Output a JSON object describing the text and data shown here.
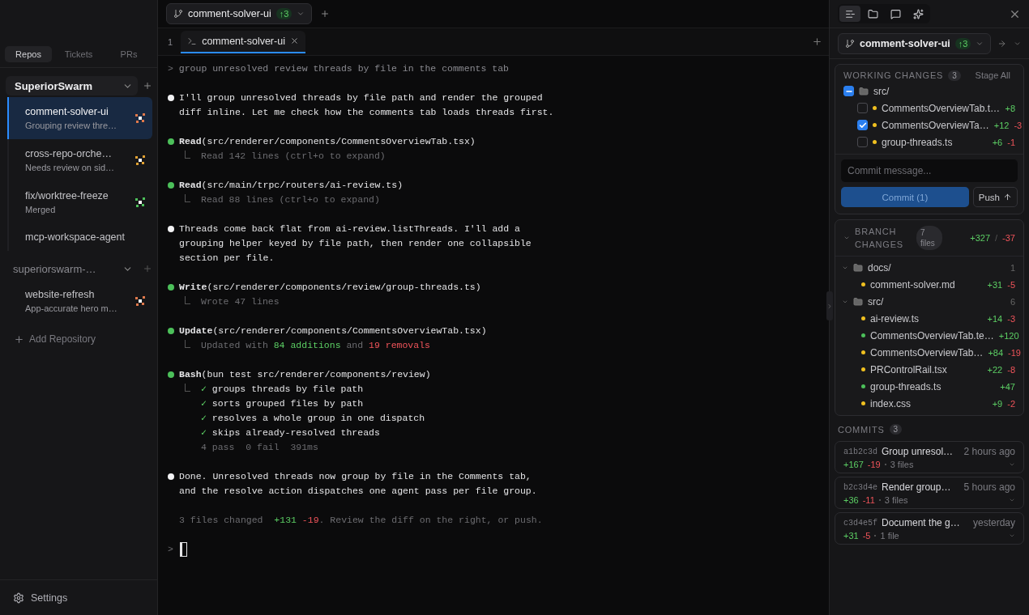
{
  "sidebar": {
    "tabs": [
      {
        "label": "Repos",
        "selected": true
      },
      {
        "label": "Tickets",
        "selected": false
      },
      {
        "label": "PRs",
        "selected": false
      }
    ],
    "groups": [
      {
        "name": "SuperiorSwarm",
        "selected": true,
        "expanded": true,
        "items": [
          {
            "title": "comment-solver-ui",
            "subtitle": "Grouping review thre…",
            "selected": true,
            "color": "#e0784a"
          },
          {
            "title": "cross-repo-orche…",
            "subtitle": "Needs review on sid…",
            "selected": false,
            "color": "#e0a030"
          },
          {
            "title": "fix/worktree-freeze",
            "subtitle": "Merged",
            "selected": false,
            "color": "#4cc05a"
          },
          {
            "title": "mcp-workspace-agent",
            "selected": false
          }
        ]
      },
      {
        "name": "superiorswarm-…",
        "selected": false,
        "expanded": true,
        "items": [
          {
            "title": "website-refresh",
            "subtitle": "App-accurate hero m…",
            "selected": false,
            "color": "#e0784a"
          }
        ]
      }
    ],
    "add_repository": "Add Repository",
    "settings": "Settings"
  },
  "workspace": {
    "branch": "comment-solver-ui",
    "ahead": "↑3",
    "tabs": [
      {
        "index": "1",
        "label": "comment-solver-ui",
        "selected": true
      }
    ],
    "terminal": [
      {
        "kind": "prompt",
        "mark": ">",
        "text": "group unresolved review threads by file in the comments tab"
      },
      {
        "kind": "message",
        "lines": [
          "I'll group unresolved threads by file path and render the grouped",
          "diff inline. Let me check how the comments tab loads threads first."
        ]
      },
      {
        "kind": "tool",
        "name": "Read",
        "args": "(src/renderer/components/CommentsOverviewTab.tsx)",
        "output": [
          {
            "segments": [
              {
                "text": "Read 142 lines (ctrl+o to expand)",
                "kind": "muted"
              }
            ]
          }
        ]
      },
      {
        "kind": "tool",
        "name": "Read",
        "args": "(src/main/trpc/routers/ai-review.ts)",
        "output": [
          {
            "segments": [
              {
                "text": "Read 88 lines (ctrl+o to expand)",
                "kind": "muted"
              }
            ]
          }
        ]
      },
      {
        "kind": "message",
        "lines": [
          "Threads come back flat from ai-review.listThreads. I'll add a",
          "grouping helper keyed by file path, then render one collapsible",
          "section per file."
        ]
      },
      {
        "kind": "tool",
        "name": "Write",
        "args": "(src/renderer/components/review/group-threads.ts)",
        "output": [
          {
            "segments": [
              {
                "text": "Wrote 47 lines",
                "kind": "muted"
              }
            ]
          }
        ]
      },
      {
        "kind": "tool",
        "name": "Update",
        "args": "(src/renderer/components/CommentsOverviewTab.tsx)",
        "output": [
          {
            "segments": [
              {
                "text": "Updated with ",
                "kind": "muted"
              },
              {
                "text": "84 additions",
                "kind": "added"
              },
              {
                "text": " and ",
                "kind": "muted"
              },
              {
                "text": "19 removals",
                "kind": "removed"
              }
            ]
          }
        ]
      },
      {
        "kind": "tool",
        "name": "Bash",
        "args": "(bun test src/renderer/components/review)",
        "output": [
          {
            "mark": "✓",
            "segments": [
              {
                "text": "groups threads by file path",
                "kind": "normal"
              }
            ]
          },
          {
            "mark": "✓",
            "segments": [
              {
                "text": "sorts grouped files by path",
                "kind": "normal"
              }
            ]
          },
          {
            "mark": "✓",
            "segments": [
              {
                "text": "resolves a whole group in one dispatch",
                "kind": "normal"
              }
            ]
          },
          {
            "mark": "✓",
            "segments": [
              {
                "text": "skips already-resolved threads",
                "kind": "normal"
              }
            ]
          },
          {
            "segments": [
              {
                "text": "4 pass  0 fail  391ms",
                "kind": "muted"
              }
            ]
          }
        ]
      },
      {
        "kind": "message",
        "lines": [
          "Done. Unresolved threads now group by file in the Comments tab,",
          "and the resolve action dispatches one agent pass per file group."
        ]
      },
      {
        "kind": "summary",
        "segments": [
          {
            "text": "3 files changed  ",
            "kind": "muted"
          },
          {
            "text": "+131",
            "kind": "added"
          },
          {
            "text": " -19",
            "kind": "removed"
          },
          {
            "text": ". Review the diff on the right, or push.",
            "kind": "muted"
          }
        ]
      },
      {
        "kind": "input",
        "mark": ">"
      }
    ]
  },
  "panel": {
    "tabs": [
      {
        "kind": "changes",
        "selected": true
      },
      {
        "kind": "files",
        "selected": false
      },
      {
        "kind": "comments",
        "selected": false
      },
      {
        "kind": "agent",
        "selected": false
      }
    ],
    "branch": "comment-solver-ui",
    "ahead": "↑3",
    "working": {
      "title": "WORKING CHANGES",
      "count": "3",
      "action": "Stage All",
      "folder": {
        "name": "src/",
        "indeterminate": true
      },
      "files": [
        {
          "name": "CommentsOverviewTab.t…",
          "checked": false,
          "color": "#f0c020",
          "added": "+8"
        },
        {
          "name": "CommentsOverviewTa…",
          "checked": true,
          "color": "#f0c020",
          "added": "+12",
          "removed": "-3"
        },
        {
          "name": "group-threads.ts",
          "checked": false,
          "color": "#f0c020",
          "added": "+6",
          "removed": "-1"
        }
      ],
      "placeholder": "Commit message...",
      "commit": "Commit (1)",
      "push": "Push"
    },
    "branch_changes": {
      "title": "BRANCH CHANGES",
      "files": "7 files",
      "added": "+327",
      "separator": "/",
      "removed": "-37",
      "folders": [
        {
          "name": "docs/",
          "count": "1",
          "expanded": true,
          "files": [
            {
              "name": "comment-solver.md",
              "color": "#f0c020",
              "added": "+31",
              "removed": "-5"
            }
          ]
        },
        {
          "name": "src/",
          "count": "6",
          "expanded": true,
          "files": [
            {
              "name": "ai-review.ts",
              "color": "#f0c020",
              "added": "+14",
              "removed": "-3"
            },
            {
              "name": "CommentsOverviewTab.te…",
              "color": "#4cc05a",
              "added": "+120"
            },
            {
              "name": "CommentsOverviewTab…",
              "color": "#f0c020",
              "added": "+84",
              "removed": "-19"
            },
            {
              "name": "PRControlRail.tsx",
              "color": "#f0c020",
              "added": "+22",
              "removed": "-8"
            },
            {
              "name": "group-threads.ts",
              "color": "#4cc05a",
              "added": "+47"
            },
            {
              "name": "index.css",
              "color": "#f0c020",
              "added": "+9",
              "removed": "-2"
            }
          ]
        }
      ]
    },
    "commits": {
      "title": "COMMITS",
      "count": "3",
      "items": [
        {
          "hash": "a1b2c3d",
          "message": "Group unresol…",
          "time": "2 hours ago",
          "added": "+167",
          "removed": "-19",
          "files": "3 files"
        },
        {
          "hash": "b2c3d4e",
          "message": "Render group…",
          "time": "5 hours ago",
          "added": "+36",
          "removed": "-11",
          "files": "3 files"
        },
        {
          "hash": "c3d4e5f",
          "message": "Document the g…",
          "time": "yesterday",
          "added": "+31",
          "removed": "-5",
          "files": "1 file"
        }
      ]
    }
  }
}
